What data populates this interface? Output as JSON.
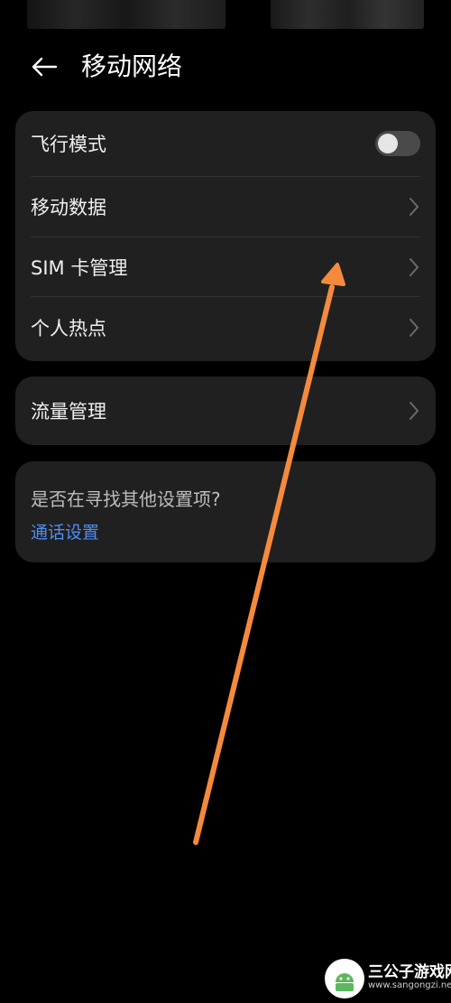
{
  "header": {
    "title": "移动网络"
  },
  "card_main": {
    "items": [
      {
        "label": "飞行模式",
        "type": "toggle",
        "toggle_on": false
      },
      {
        "label": "移动数据",
        "type": "chevron"
      },
      {
        "label": "SIM 卡管理",
        "type": "chevron"
      },
      {
        "label": "个人热点",
        "type": "chevron"
      }
    ]
  },
  "card_traffic": {
    "label": "流量管理"
  },
  "hint_card": {
    "question": "是否在寻找其他设置项?",
    "link": "通话设置"
  },
  "colors": {
    "background": "#000000",
    "card": "#202020",
    "link": "#4f8ef7",
    "annotation_arrow": "#f58a3c"
  },
  "watermark": {
    "title": "三公子游戏网",
    "url": "www.sangongzi.net"
  }
}
